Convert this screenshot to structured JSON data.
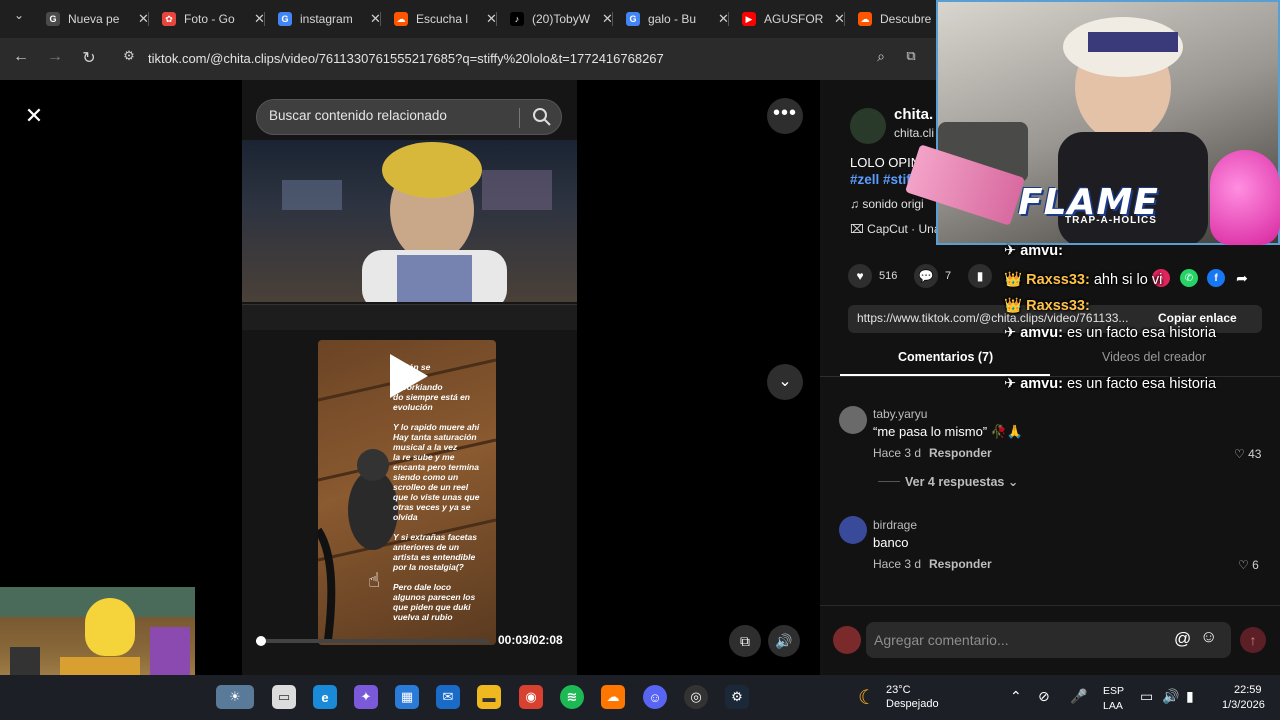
{
  "browser": {
    "tabs": [
      {
        "label": "Nueva pe",
        "color": "#4a4a4a",
        "glyph": "G"
      },
      {
        "label": "Foto - Go",
        "color": "#e8453c",
        "glyph": "✿"
      },
      {
        "label": "instagram",
        "color": "#4285f4",
        "glyph": "G"
      },
      {
        "label": "Escucha l",
        "color": "#ff5500",
        "glyph": "☁"
      },
      {
        "label": "(20)TobyW",
        "color": "#000000",
        "glyph": "♪"
      },
      {
        "label": "galo - Bu",
        "color": "#4285f4",
        "glyph": "G"
      },
      {
        "label": "AGUSFOR",
        "color": "#ff0000",
        "glyph": "▶"
      },
      {
        "label": "Descubre",
        "color": "#ff5500",
        "glyph": "☁"
      }
    ],
    "url": "tiktok.com/@chita.clips/video/7611330761555217685?q=stiffy%20lolo&t=1772416768267"
  },
  "player": {
    "search_placeholder": "Buscar contenido relacionado",
    "time": "00:03/02:08",
    "progress": 0.023
  },
  "video_post": {
    "author_name": "chita.",
    "author_handle": "chita.cli",
    "description": "LOLO OPINA E",
    "hashtags": "#zell #stiff",
    "music": "♫  sonido origi",
    "capcut": "⌧  CapCut · Una edición de la"
  },
  "actions": {
    "likes": "516",
    "comments": "7",
    "saves": ""
  },
  "link": {
    "url": "https://www.tiktok.com/@chita.clips/video/761133...",
    "copy_label": "Copiar enlace"
  },
  "tabs": {
    "comments": "Comentarios (7)",
    "creator_videos": "Videos del creador"
  },
  "comments": [
    {
      "user": "taby.yaryu",
      "text": "“me pasa lo mismo” 🥀🙏",
      "meta": "Hace 3 d",
      "reply": "Responder",
      "likes": "43"
    },
    {
      "user": "birdrage",
      "text": "banco",
      "meta": "Hace 3 d",
      "reply": "Responder",
      "likes": "6"
    }
  ],
  "view_replies": "Ver 4 respuestas",
  "comment_input_placeholder": "Agregar comentario...",
  "overlay": {
    "brand": "FLAME",
    "brand_sub": "TRAP-A-HOLICS",
    "chat": [
      {
        "name": "amvu:",
        "msg": "",
        "gold": false
      },
      {
        "name": "Raxss33:",
        "msg": "ahh si lo vi",
        "gold": true
      },
      {
        "name": "Raxss33:",
        "msg": "",
        "gold": true
      },
      {
        "name": "amvu:",
        "msg": "es un facto esa historia",
        "gold": false
      },
      {
        "name": "amvu:",
        "msg": "es un facto esa historia",
        "gold": false
      }
    ]
  },
  "story": {
    "lines": [
      "ración se",
      "con el",
      "y workiando",
      "do siempre está en",
      "evolución",
      "Y lo rapido muere ahi",
      "Hay tanta saturación",
      "musical a la vez",
      "la re sube y me",
      "encanta pero termina",
      "siendo como un",
      "scrolleo de un reel",
      "que lo viste unas que",
      "otras veces y ya se",
      "olvida",
      "Y si extrañas facetas",
      "anteriores de un",
      "artista es entendible",
      "por la nostalgia(?",
      "Pero dale loco",
      "algunos parecen los",
      "que piden que duki",
      "vuelva al rubio"
    ]
  },
  "taskbar": {
    "temp": "23°C",
    "weather": "Despejado",
    "lang_line1": "ESP",
    "lang_line2": "LAA",
    "time": "22:59",
    "date": "1/3/2026"
  }
}
